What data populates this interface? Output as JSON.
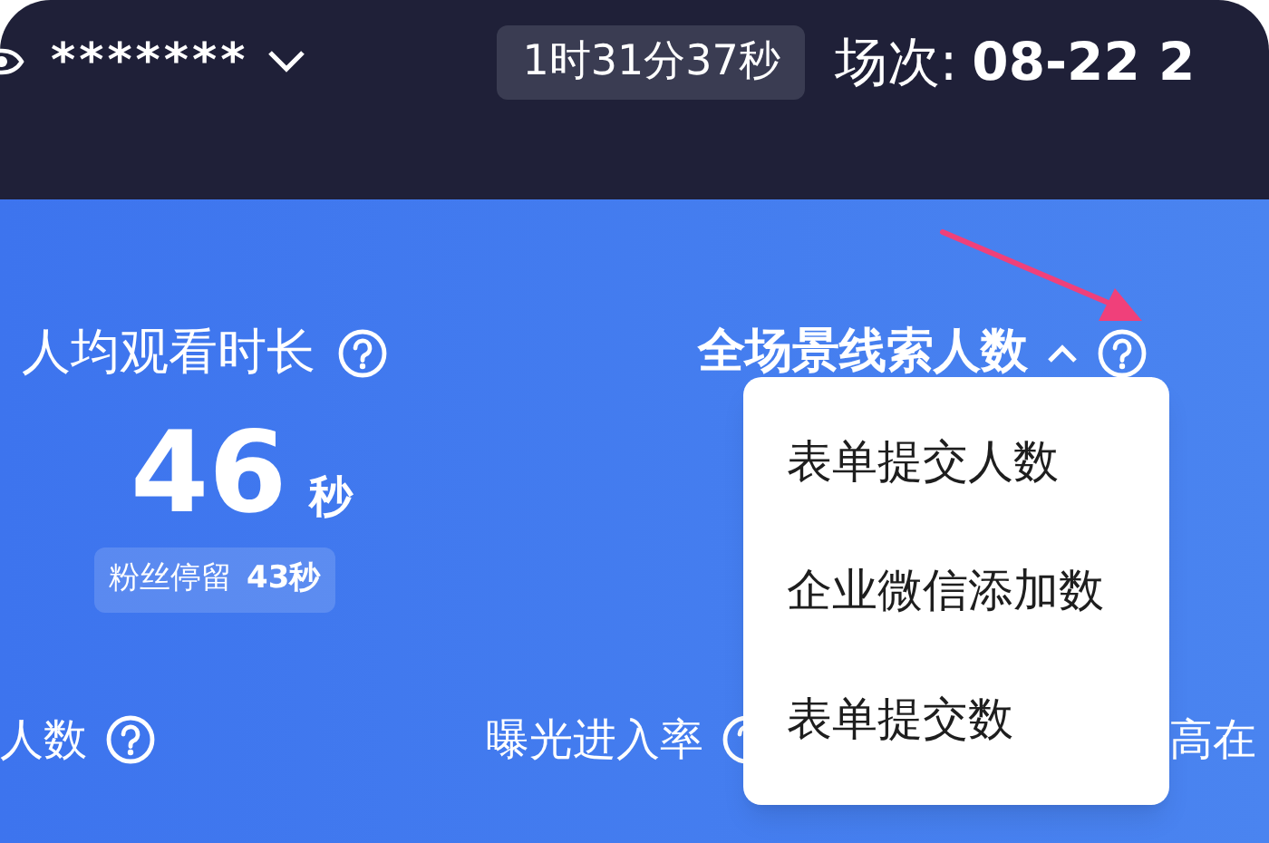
{
  "header": {
    "account": "*******",
    "duration": "1时31分37秒",
    "session_label": "场次:",
    "session_value": "08-22 2"
  },
  "metrics": [
    {
      "title": "人均观看时长",
      "value": "46",
      "unit": "秒",
      "sub_label": "粉丝停留",
      "sub_value": "43秒"
    },
    {
      "title": "全场景线索人数",
      "expanded": true
    }
  ],
  "dropdown": {
    "items": [
      "表单提交人数",
      "企业微信添加数",
      "表单提交数"
    ]
  },
  "bottom_metrics": [
    {
      "title": "人数",
      "help": true
    },
    {
      "title": "曝光进入率",
      "help": true
    },
    {
      "title": "高在",
      "help": false
    }
  ]
}
